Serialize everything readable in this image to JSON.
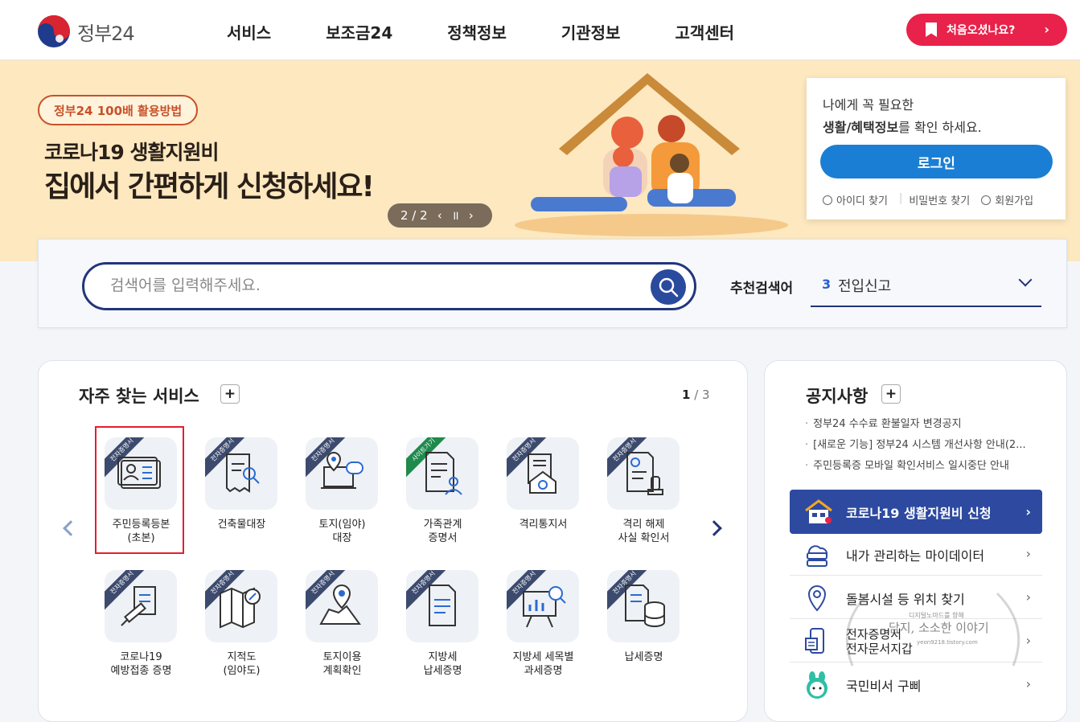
{
  "header": {
    "logo_text": "정부24",
    "nav": [
      "서비스",
      "보조금24",
      "정책정보",
      "기관정보",
      "고객센터"
    ],
    "first_visit_button": "처음오셨나요?"
  },
  "banner": {
    "pill": "정부24 100배 활용방법",
    "subtitle": "코로나19 생활지원비",
    "title": "집에서 간편하게 신청하세요!",
    "pager": "2 / 2"
  },
  "login": {
    "line1": "나에게 꼭 필요한",
    "line2_bold": "생활/혜택정보",
    "line2_rest": "를 확인 하세요.",
    "button": "로그인",
    "find_id": "아이디 찾기",
    "find_pw": "비밀번호 찾기",
    "signup": "회원가입"
  },
  "search": {
    "placeholder": "검색어를 입력해주세요.",
    "recommend_label": "추천검색어",
    "recommend_rank": "3",
    "recommend_term": "전입신고"
  },
  "services": {
    "title": "자주 찾는 서비스",
    "page_current": "1",
    "page_total": "/ 3",
    "items": [
      {
        "badge": "전자증명서",
        "label": "주민등록등본\n(초본)"
      },
      {
        "badge": "전자증명서",
        "label": "건축물대장"
      },
      {
        "badge": "전자증명서",
        "label": "토지(임야)\n대장"
      },
      {
        "badge": "사이트가기",
        "label": "가족관계\n증명서"
      },
      {
        "badge": "전자증명서",
        "label": "격리통지서"
      },
      {
        "badge": "전자증명서",
        "label": "격리 해제\n사실 확인서"
      },
      {
        "badge": "전자증명서",
        "label": "코로나19\n예방접종 증명"
      },
      {
        "badge": "전자증명서",
        "label": "지적도\n(임야도)"
      },
      {
        "badge": "전자증명서",
        "label": "토지이용\n계획확인"
      },
      {
        "badge": "전자증명서",
        "label": "지방세\n납세증명"
      },
      {
        "badge": "전자증명서",
        "label": "지방세 세목별\n과세증명"
      },
      {
        "badge": "전자증명서",
        "label": "납세증명"
      }
    ]
  },
  "notices": {
    "title": "공지사항",
    "items": [
      "정부24 수수료 환불일자 변경공지",
      "[새로운 기능] 정부24 시스템 개선사항 안내(2...",
      "주민등록증 모바일 확인서비스 일시중단 안내"
    ],
    "covid_button": "코로나19 생활지원비 신청",
    "quick": [
      "내가 관리하는 마이데이터",
      "돌봄시설 등 위치 찾기",
      "전자증명서\n전자문서지갑",
      "국민비서 구삐"
    ]
  },
  "watermark": {
    "line1": "디지털노마드를 향해",
    "line2": "담지, 소소한 이야기",
    "line3": "yeon9218.tistory.com"
  },
  "colors": {
    "brand_red": "#e8224a",
    "navy": "#23357a",
    "login_blue": "#1a7fd4",
    "covid_blue": "#2d4aa0",
    "banner_bg": "#fde8bf"
  }
}
